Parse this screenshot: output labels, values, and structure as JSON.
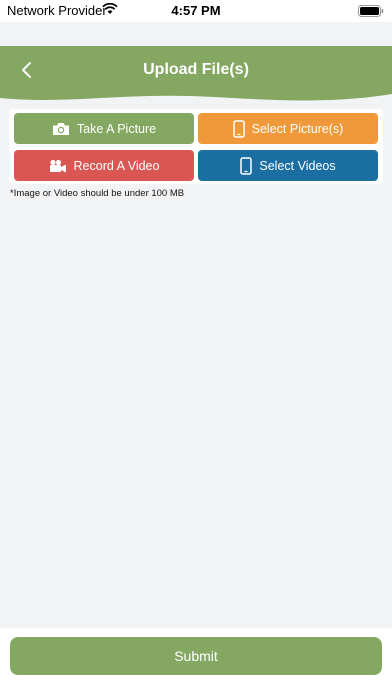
{
  "status_bar": {
    "carrier": "Network Provider",
    "time": "4:57 PM"
  },
  "header": {
    "title": "Upload File(s)",
    "color": "#84a761"
  },
  "buttons": {
    "take_picture": "Take A Picture",
    "select_pictures": "Select Picture(s)",
    "record_video": "Record A Video",
    "select_videos": "Select Videos"
  },
  "note": "*Image or Video should be under 100 MB",
  "footer": {
    "submit": "Submit"
  },
  "colors": {
    "green": "#84a761",
    "orange": "#f0993b",
    "red": "#d95653",
    "blue": "#1b6ea2"
  },
  "icons": [
    "back-chevron-icon",
    "camera-icon",
    "phone-icon",
    "video-camera-icon",
    "wifi-icon",
    "battery-icon"
  ]
}
